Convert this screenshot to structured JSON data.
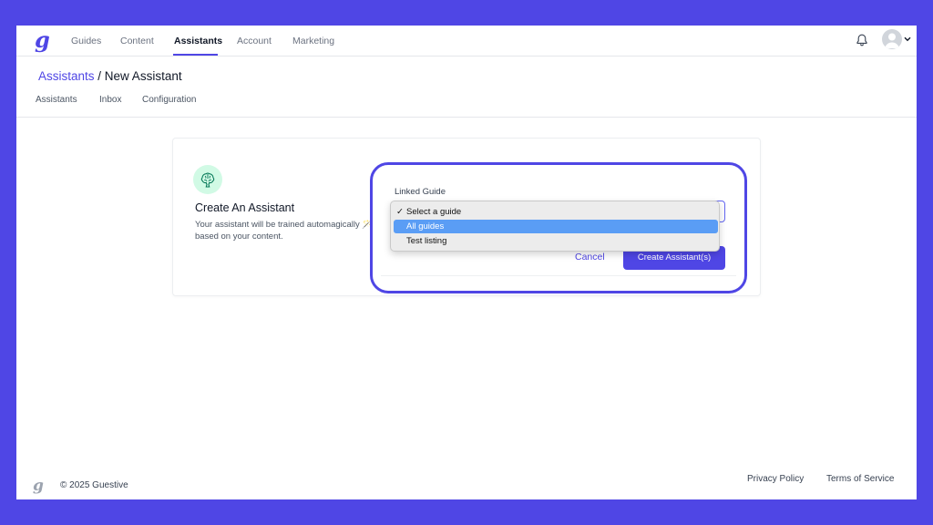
{
  "app": {
    "logo_glyph": "g",
    "accent_color": "#4f46e5"
  },
  "nav": {
    "items": [
      {
        "label": "Guides"
      },
      {
        "label": "Content"
      },
      {
        "label": "Assistants",
        "active": true
      },
      {
        "label": "Account"
      },
      {
        "label": "Marketing"
      }
    ],
    "notification_icon": "bell-icon",
    "avatar_icon": "user-avatar-icon"
  },
  "breadcrumb": {
    "parent": "Assistants",
    "separator": " / ",
    "current": "New Assistant"
  },
  "subnav": {
    "items": [
      {
        "label": "Assistants"
      },
      {
        "label": "Inbox"
      },
      {
        "label": "Configuration"
      }
    ]
  },
  "card": {
    "icon": "brain-icon",
    "title": "Create An Assistant",
    "description": "Your assistant will be trained automagically 🪄 based on your content."
  },
  "form": {
    "linked_guide_label": "Linked Guide",
    "dropdown": {
      "selected": "Select a guide",
      "check": "✓",
      "options": [
        {
          "label": "Select a guide",
          "checked": true
        },
        {
          "label": "All guides",
          "highlighted": true
        },
        {
          "label": "Test listing"
        }
      ]
    },
    "cancel_label": "Cancel",
    "submit_label": "Create Assistant(s)"
  },
  "footer": {
    "logo_glyph": "g",
    "copyright": "© 2025 Guestive",
    "links": [
      {
        "label": "Privacy Policy"
      },
      {
        "label": "Terms of Service"
      }
    ]
  }
}
